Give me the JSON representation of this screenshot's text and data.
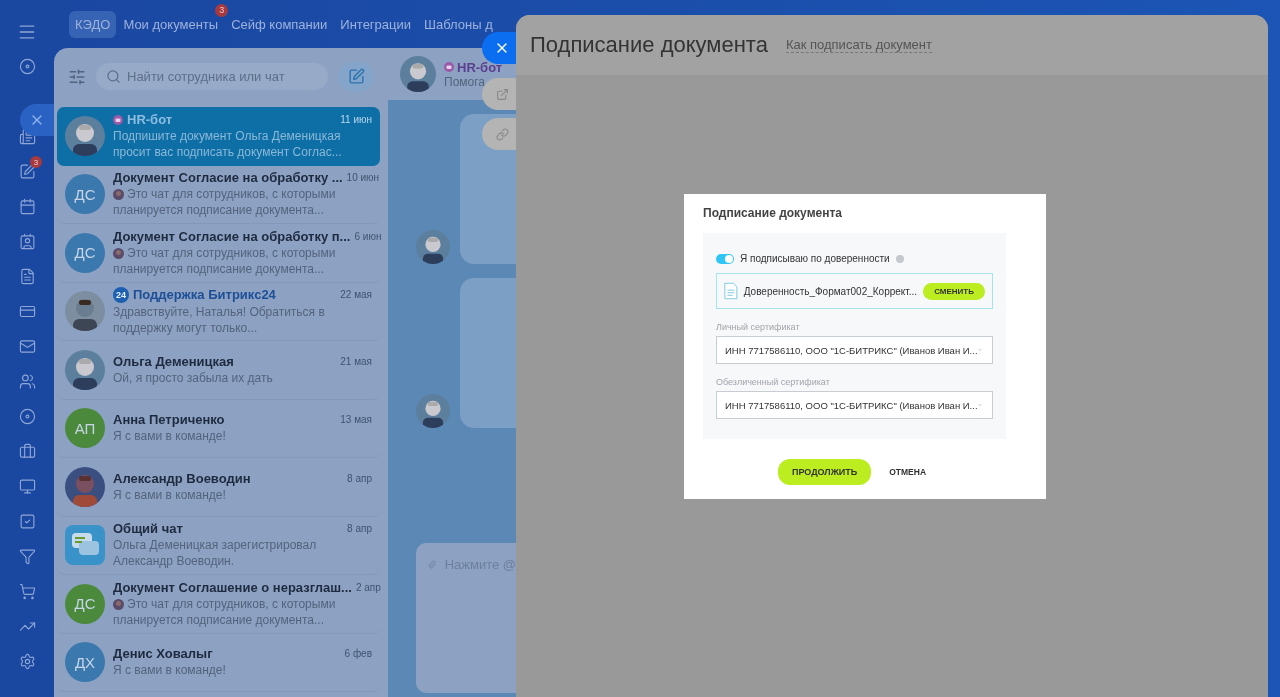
{
  "top_nav": {
    "tabs": [
      {
        "label": "КЭДО",
        "selected": true
      },
      {
        "label": "Мои документы",
        "selected": false,
        "badge": "3"
      },
      {
        "label": "Сейф компании",
        "selected": false
      },
      {
        "label": "Интеграции",
        "selected": false
      },
      {
        "label": "Шаблоны д",
        "selected": false
      }
    ]
  },
  "rail": {
    "badge": "3"
  },
  "chat_list": {
    "search": {
      "placeholder": "Найти сотрудника или чат"
    },
    "chats": [
      {
        "title": "HR-бот",
        "title_icon": {
          "kind": "bot"
        },
        "time": "11 июн",
        "preview": "Подпишите документ Ольга Деменицкая просит вас подписать документ Соглас...",
        "author_avatar": false,
        "selected": true
      },
      {
        "avatar": {
          "kind": "initials",
          "initials": "ДС",
          "color": "#3a78ad"
        },
        "title": "Документ Согласие на обработку ...",
        "time": "10 июн",
        "preview": "Это чат для сотрудников, с которыми планируется подписание документа...",
        "author_avatar": true,
        "selected": false
      },
      {
        "avatar": {
          "kind": "initials",
          "initials": "ДС",
          "color": "#3a78ad"
        },
        "title": "Документ Согласие на обработку п...",
        "time": "6 июн",
        "preview": "Это чат для сотрудников, с которыми планируется подписание документа...",
        "author_avatar": true,
        "selected": false
      },
      {
        "title": "Поддержка Битрикс24",
        "title_icon": {
          "kind": "support",
          "text": "24"
        },
        "time": "22 мая",
        "preview": "Здравствуйте, Наталья! Обратиться в поддержку могут только...",
        "author_avatar": false,
        "selected": false
      },
      {
        "title": "Ольга Деменицкая",
        "time": "21 мая",
        "preview": "Ой, я просто забыла их дать",
        "author_avatar": false,
        "selected": false
      },
      {
        "avatar": {
          "kind": "initials",
          "initials": "АП",
          "color": "#4b8a3c"
        },
        "title": "Анна Петриченко",
        "time": "13 мая",
        "preview": "Я с вами в команде!",
        "author_avatar": false,
        "selected": false
      },
      {
        "title": "Александр Воеводин",
        "time": "8 апр",
        "preview": "Я с вами в команде!",
        "author_avatar": false,
        "selected": false
      },
      {
        "avatar": {
          "kind": "chat"
        },
        "title": "Общий чат",
        "time": "8 апр",
        "preview": "Ольга Деменицкая зарегистрировал Александр Воеводин.",
        "author_avatar": false,
        "selected": false
      },
      {
        "avatar": {
          "kind": "initials",
          "initials": "ДС",
          "color": "#4b8a3c"
        },
        "title": "Документ Соглашение о неразглаш...",
        "time": "2 апр",
        "preview": "Это чат для сотрудников, с которыми планируется подписание документа...",
        "author_avatar": true,
        "selected": false
      },
      {
        "avatar": {
          "kind": "initials",
          "initials": "ДХ",
          "color": "#3a78ad"
        },
        "title": "Денис Ховалыг",
        "time": "6 фев",
        "preview": "Я с вами в команде!",
        "author_avatar": false,
        "selected": false
      }
    ]
  },
  "chat": {
    "name": "HR-бот",
    "status": "Помога",
    "composer": {
      "placeholder": "Нажмите @"
    }
  },
  "slider": {
    "title": "Подписание документа",
    "help_link": "Как подписать документ"
  },
  "dialog": {
    "title": "Подписание документа",
    "toggle": {
      "label": "Я подписываю по доверенности",
      "on": true
    },
    "file": {
      "name": "Доверенность_Формат002_Коррект...",
      "button": "СМЕНИТЬ"
    },
    "fields": [
      {
        "label": "Личный сертификат",
        "value": "ИНН 7717586110, ООО \"1С-БИТРИКС\" (Иванов Иван И..."
      },
      {
        "label": "Обезличенный сертификат",
        "value": "ИНН 7717586110, ООО \"1С-БИТРИКС\" (Иванов Иван И..."
      }
    ],
    "buttons": {
      "primary": "ПРОДОЛЖИТЬ",
      "cancel": "ОТМЕНА"
    }
  }
}
